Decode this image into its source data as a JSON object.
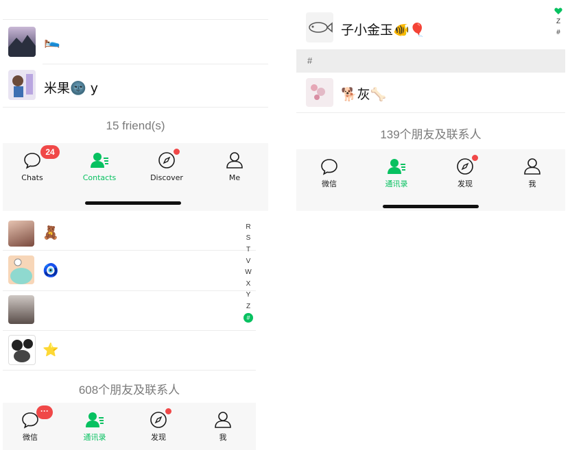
{
  "panel_top_left": {
    "contacts": [
      {
        "name": "🛌"
      },
      {
        "name": "米果🌚 y"
      }
    ],
    "friend_count": "15 friend(s)",
    "tabs": [
      {
        "label": "Chats",
        "badge": "24"
      },
      {
        "label": "Contacts"
      },
      {
        "label": "Discover"
      },
      {
        "label": "Me"
      }
    ]
  },
  "panel_bottom_left": {
    "index_letters": [
      "R",
      "S",
      "T",
      "V",
      "W",
      "X",
      "Y",
      "Z"
    ],
    "index_hash": "#",
    "contacts": [
      {
        "name": "🧸"
      },
      {
        "name": "🧿"
      },
      {
        "name": ""
      },
      {
        "name": "⭐"
      }
    ],
    "friend_count": "608个朋友及联系人",
    "tabs": [
      {
        "label": "微信",
        "badge": "···"
      },
      {
        "label": "通讯录"
      },
      {
        "label": "发现"
      },
      {
        "label": "我"
      }
    ]
  },
  "panel_right": {
    "index_letters": [
      "Z",
      "#"
    ],
    "contacts_top": [
      {
        "name": "子小金玉🐠🎈"
      }
    ],
    "section_header": "#",
    "contacts_hash": [
      {
        "name": "🐕灰🦴"
      }
    ],
    "friend_count": "139个朋友及联系人",
    "tabs": [
      {
        "label": "微信"
      },
      {
        "label": "通讯录"
      },
      {
        "label": "发现"
      },
      {
        "label": "我"
      }
    ]
  },
  "colors": {
    "accent_green": "#07c160",
    "badge_red": "#f04848",
    "tabbar_bg": "#f7f7f7",
    "muted_text": "#7a7a7a"
  }
}
